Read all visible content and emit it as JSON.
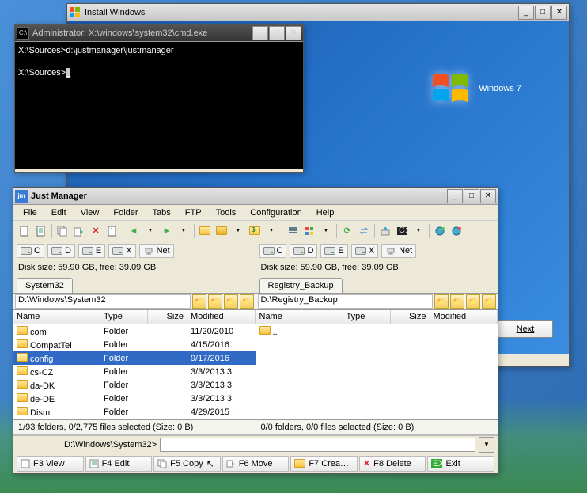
{
  "install_window": {
    "title": "Install Windows",
    "logo_text": "Windows",
    "logo_version": "7",
    "next_button": "Next"
  },
  "cmd_window": {
    "title": "Administrator: X:\\windows\\system32\\cmd.exe",
    "line1": "X:\\Sources>d:\\justmanager\\justmanager",
    "line2": "X:\\Sources>"
  },
  "jm": {
    "title": "Just Manager",
    "menu": [
      "File",
      "Edit",
      "View",
      "Folder",
      "Tabs",
      "FTP",
      "Tools",
      "Configuration",
      "Help"
    ],
    "drives": [
      {
        "label": "C"
      },
      {
        "label": "D"
      },
      {
        "label": "E"
      },
      {
        "label": "X"
      },
      {
        "label": "Net"
      }
    ],
    "left": {
      "disk_info": "Disk size: 59.90 GB, free: 39.09 GB",
      "tab": "System32",
      "path": "D:\\Windows\\System32",
      "cols": {
        "name": "Name",
        "type": "Type",
        "size": "Size",
        "mod": "Modified"
      },
      "rows": [
        {
          "name": "com",
          "type": "Folder",
          "size": "",
          "mod": "11/20/2010"
        },
        {
          "name": "CompatTel",
          "type": "Folder",
          "size": "",
          "mod": "4/15/2016"
        },
        {
          "name": "config",
          "type": "Folder",
          "size": "",
          "mod": "9/17/2016",
          "sel": true
        },
        {
          "name": "cs-CZ",
          "type": "Folder",
          "size": "",
          "mod": "3/3/2013 3:"
        },
        {
          "name": "da-DK",
          "type": "Folder",
          "size": "",
          "mod": "3/3/2013 3:"
        },
        {
          "name": "de-DE",
          "type": "Folder",
          "size": "",
          "mod": "3/3/2013 3:"
        },
        {
          "name": "Dism",
          "type": "Folder",
          "size": "",
          "mod": "4/29/2015 :"
        }
      ],
      "status": "1/93 folders, 0/2,775 files selected (Size: 0 B)"
    },
    "right": {
      "disk_info": "Disk size: 59.90 GB, free: 39.09 GB",
      "tab": "Registry_Backup",
      "path": "D:\\Registry_Backup",
      "cols": {
        "name": "Name",
        "type": "Type",
        "size": "Size",
        "mod": "Modified"
      },
      "rows": [
        {
          "name": "..",
          "type": "",
          "size": "",
          "mod": ""
        }
      ],
      "status": "0/0 folders, 0/0 files selected (Size: 0 B)"
    },
    "cmd_prompt": "D:\\Windows\\System32>",
    "fkeys": [
      {
        "label": "F3 View"
      },
      {
        "label": "F4 Edit"
      },
      {
        "label": "F5 Copy"
      },
      {
        "label": "F6 Move"
      },
      {
        "label": "F7 Crea…"
      },
      {
        "label": "F8 Delete"
      },
      {
        "label": "Exit"
      }
    ]
  }
}
